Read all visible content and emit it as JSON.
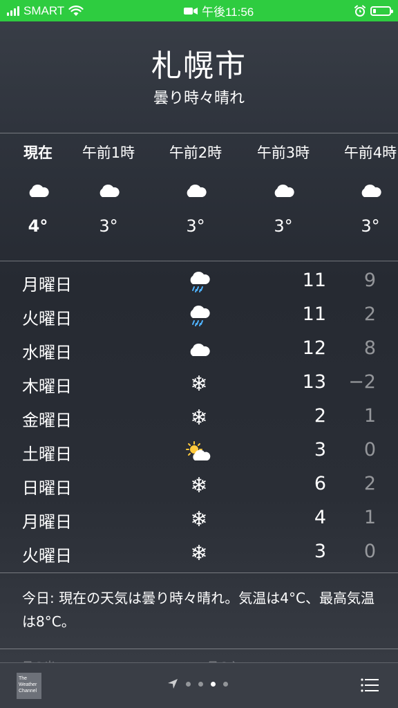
{
  "status_bar": {
    "carrier": "SMART",
    "time": "午後11:56"
  },
  "header": {
    "city": "札幌市",
    "condition": "曇り時々晴れ"
  },
  "hourly": [
    {
      "label": "現在",
      "icon": "cloud-icon",
      "temp": "4°"
    },
    {
      "label": "午前1時",
      "icon": "cloud-icon",
      "temp": "3°"
    },
    {
      "label": "午前2時",
      "icon": "cloud-icon",
      "temp": "3°"
    },
    {
      "label": "午前3時",
      "icon": "cloud-icon",
      "temp": "3°"
    },
    {
      "label": "午前4時",
      "icon": "cloud-icon",
      "temp": "3°"
    }
  ],
  "daily": [
    {
      "day": "月曜日",
      "icon": "rain-icon",
      "hi": "11",
      "lo": "9"
    },
    {
      "day": "火曜日",
      "icon": "rain-icon",
      "hi": "11",
      "lo": "2"
    },
    {
      "day": "水曜日",
      "icon": "cloud-icon",
      "hi": "12",
      "lo": "8"
    },
    {
      "day": "木曜日",
      "icon": "snow-icon",
      "hi": "13",
      "lo": "−2"
    },
    {
      "day": "金曜日",
      "icon": "snow-icon",
      "hi": "2",
      "lo": "1"
    },
    {
      "day": "土曜日",
      "icon": "partly-sunny-icon",
      "hi": "3",
      "lo": "0"
    },
    {
      "day": "日曜日",
      "icon": "snow-icon",
      "hi": "6",
      "lo": "2"
    },
    {
      "day": "月曜日",
      "icon": "snow-icon",
      "hi": "4",
      "lo": "1"
    },
    {
      "day": "火曜日",
      "icon": "snow-icon",
      "hi": "3",
      "lo": "0"
    }
  ],
  "summary": "今日: 現在の天気は曇り時々晴れ。気温は4°C、最高気温は8°C。",
  "peek": {
    "left": "日の出",
    "right": "日の入"
  },
  "toolbar": {
    "logo_text": "The Weather Channel",
    "page_count": 4,
    "active_page": 3
  },
  "colors": {
    "status_bar": "#2ecc40",
    "background": "#2a2e36"
  }
}
